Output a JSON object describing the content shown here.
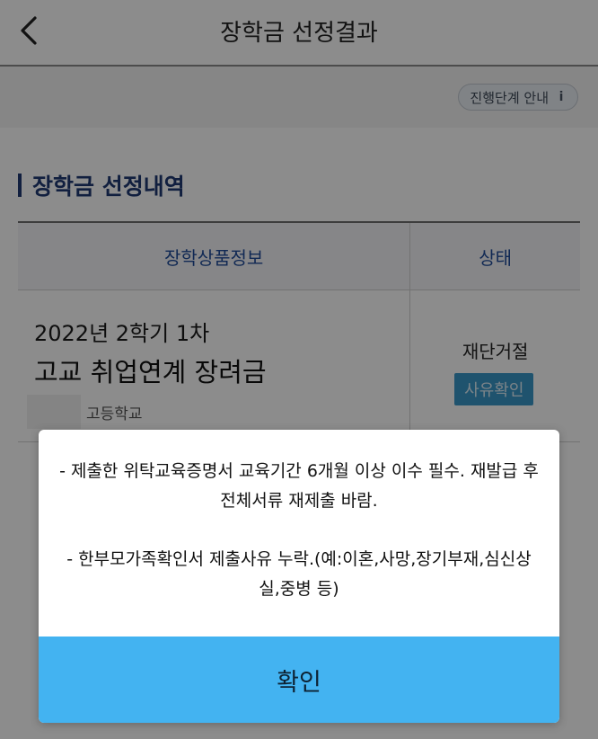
{
  "header": {
    "title": "장학금 선정결과"
  },
  "info_bar": {
    "guide_label": "진행단계 안내",
    "guide_icon": "i"
  },
  "section": {
    "title": "장학금 선정내역"
  },
  "table": {
    "columns": [
      "장학상품정보",
      "상태"
    ],
    "row": {
      "semester": "2022년 2학기 1차",
      "name": "고교 취업연계 장려금",
      "school": "고등학교",
      "status": "재단거절",
      "reason_button": "사유확인"
    }
  },
  "modal": {
    "messages": [
      "- 제출한 위탁교육증명서 교육기간 6개월 이상 이수 필수. 재발급 후 전체서류 재제출 바람.",
      "- 한부모가족확인서 제출사유 누락.(예:이혼,사망,장기부재,심신상실,중병 등)"
    ],
    "confirm_label": "확인"
  },
  "colors": {
    "primary_navy": "#1f3a73",
    "confirm_blue": "#43b3f1",
    "reason_blue": "#3a97c9"
  }
}
